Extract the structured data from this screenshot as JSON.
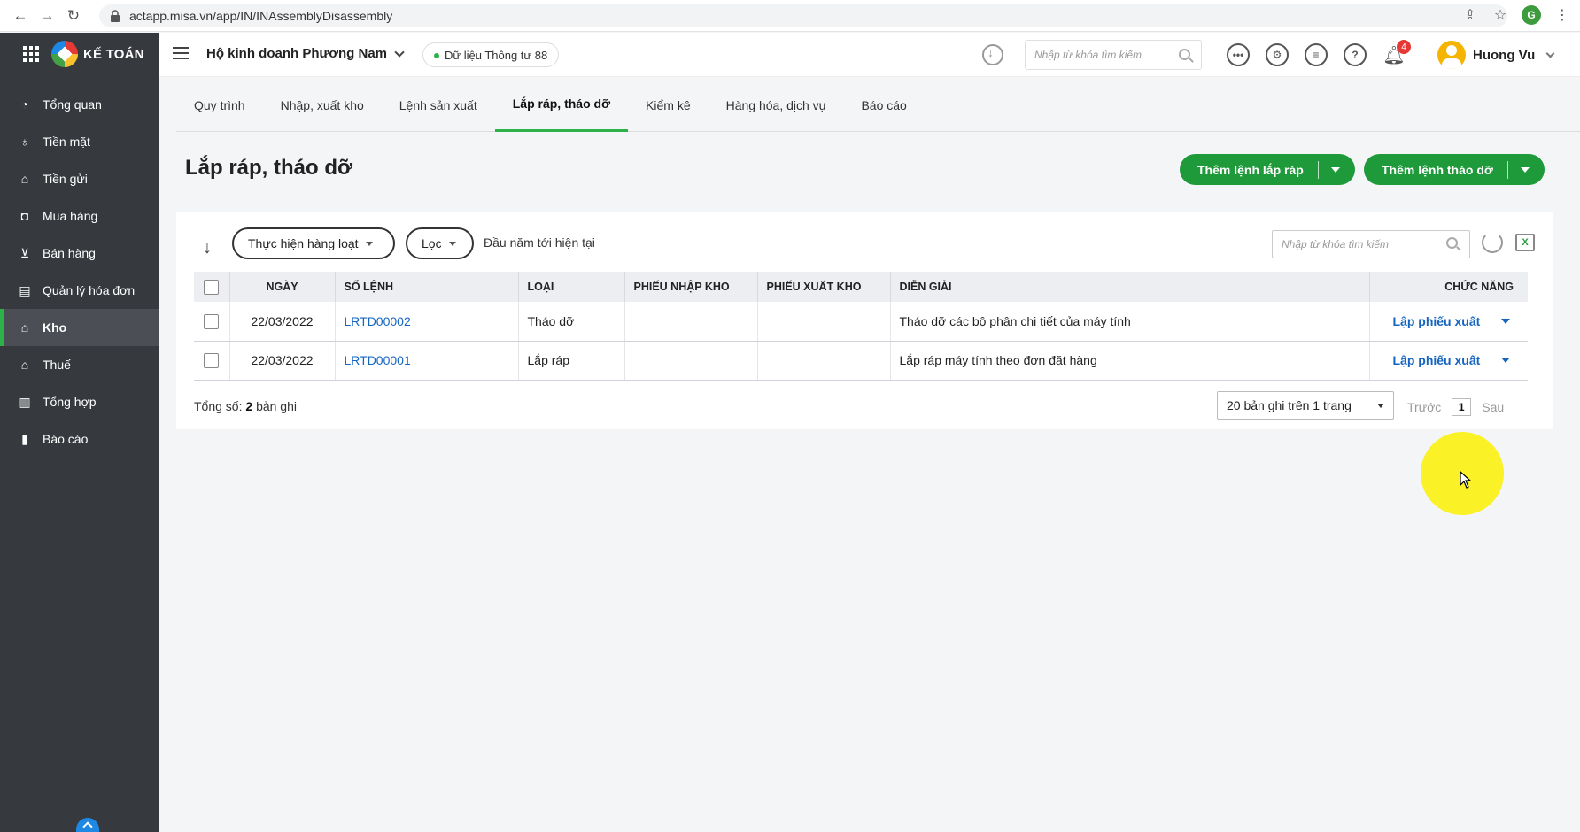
{
  "browser": {
    "url": "actapp.misa.vn/app/IN/INAssemblyDisassembly",
    "profile_initial": "G"
  },
  "brand": {
    "name": "KẾ TOÁN"
  },
  "sidebar": {
    "items": [
      {
        "label": "Tổng quan",
        "icon": "dashboard-icon"
      },
      {
        "label": "Tiền mặt",
        "icon": "money-bag-icon"
      },
      {
        "label": "Tiền gửi",
        "icon": "bank-icon"
      },
      {
        "label": "Mua hàng",
        "icon": "shopping-bag-icon"
      },
      {
        "label": "Bán hàng",
        "icon": "cart-icon"
      },
      {
        "label": "Quản lý hóa đơn",
        "icon": "invoice-icon"
      },
      {
        "label": "Kho",
        "icon": "warehouse-icon",
        "active": true
      },
      {
        "label": "Thuế",
        "icon": "tax-icon"
      },
      {
        "label": "Tổng hợp",
        "icon": "ledger-icon"
      },
      {
        "label": "Báo cáo",
        "icon": "report-icon"
      }
    ]
  },
  "header": {
    "company": "Hộ kinh doanh Phương Nam",
    "data_source": "Dữ liệu Thông tư 88",
    "search_placeholder": "Nhập từ khóa tìm kiếm",
    "notification_count": "4",
    "user_name": "Huong Vu"
  },
  "tabs": [
    {
      "label": "Quy trình"
    },
    {
      "label": "Nhập, xuất kho"
    },
    {
      "label": "Lệnh sản xuất"
    },
    {
      "label": "Lắp ráp, tháo dỡ",
      "active": true
    },
    {
      "label": "Kiểm kê"
    },
    {
      "label": "Hàng hóa, dịch vụ"
    },
    {
      "label": "Báo cáo"
    }
  ],
  "page": {
    "title": "Lắp ráp, tháo dỡ",
    "add_assembly_label": "Thêm lệnh lắp ráp",
    "add_disassembly_label": "Thêm lệnh tháo dỡ"
  },
  "toolbar": {
    "bulk_action_label": "Thực hiện hàng loạt",
    "filter_label": "Lọc",
    "period_label": "Đầu năm tới hiện tại",
    "search_placeholder": "Nhập từ khóa tìm kiếm",
    "excel_label": "X"
  },
  "table": {
    "headers": {
      "date": "NGÀY",
      "number": "SỐ LỆNH",
      "type": "LOẠI",
      "receipt": "PHIẾU NHẬP KHO",
      "issue": "PHIẾU XUẤT KHO",
      "description": "DIỄN GIẢI",
      "function": "CHỨC NĂNG"
    },
    "rows": [
      {
        "date": "22/03/2022",
        "number": "LRTD00002",
        "type": "Tháo dỡ",
        "receipt": "",
        "issue": "",
        "description": "Tháo dỡ các bộ phận chi tiết của máy tính",
        "action": "Lập phiếu xuất"
      },
      {
        "date": "22/03/2022",
        "number": "LRTD00001",
        "type": "Lắp ráp",
        "receipt": "",
        "issue": "",
        "description": "Lắp ráp máy tính theo đơn đặt hàng",
        "action": "Lập phiếu xuất"
      }
    ]
  },
  "footer": {
    "total_prefix": "Tổng số:",
    "total_count": "2",
    "total_suffix": "bản ghi",
    "page_size": "20 bản ghi trên 1 trang",
    "prev_label": "Trước",
    "current_page": "1",
    "next_label": "Sau"
  }
}
